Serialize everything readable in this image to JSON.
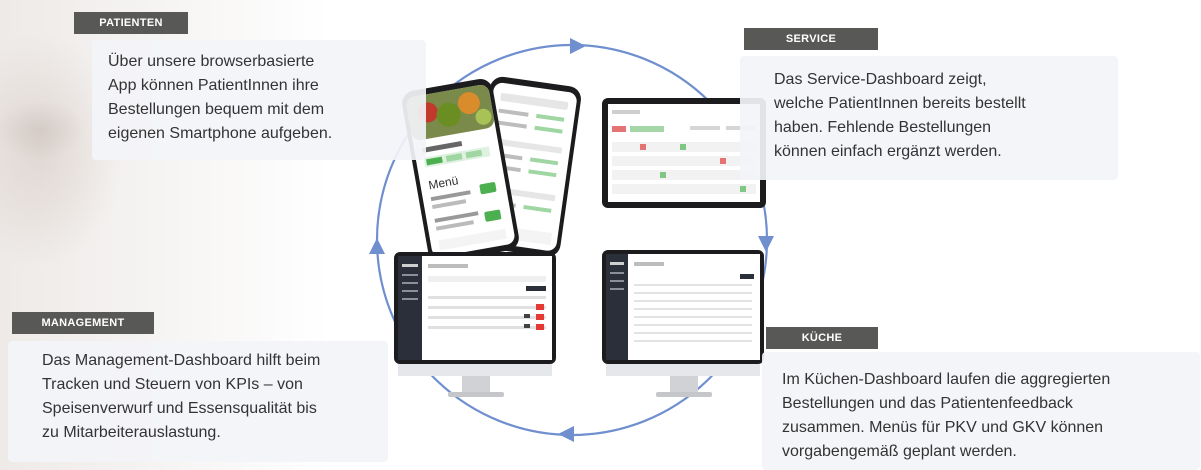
{
  "sections": {
    "patienten": {
      "tag": "PATIENTEN",
      "lines": [
        "Über unsere browserbasierte",
        "App können PatientInnen ihre",
        "Bestellungen bequem mit dem",
        "eigenen Smartphone aufgeben."
      ]
    },
    "service": {
      "tag": "SERVICE",
      "lines": [
        "Das Service-Dashboard zeigt,",
        "welche PatientInnen bereits bestellt",
        "haben. Fehlende Bestellungen",
        "können einfach ergänzt werden."
      ]
    },
    "management": {
      "tag": "MANAGEMENT",
      "lines": [
        "Das Management-Dashboard hilft beim",
        "Tracken und Steuern von KPIs – von",
        "Speisenverwurf und Essensqualität bis",
        "zu Mitarbeiterauslastung."
      ]
    },
    "kueche": {
      "tag": "KÜCHE",
      "lines": [
        "Im Küchen-Dashboard laufen die aggregierten",
        "Bestellungen und das Patientenfeedback",
        "zusammen. Menüs für PKV und GKV können",
        "vorgabengemäß geplant werden."
      ]
    }
  },
  "phone_screen": {
    "section_title": "Menü"
  },
  "colors": {
    "tag_bg": "#585856",
    "cycle_arrow": "#6f8fcf",
    "box_bg": "#f3f4f8",
    "accent_green": "#4caf50",
    "dashboard_sidebar": "#2b2f3a"
  }
}
